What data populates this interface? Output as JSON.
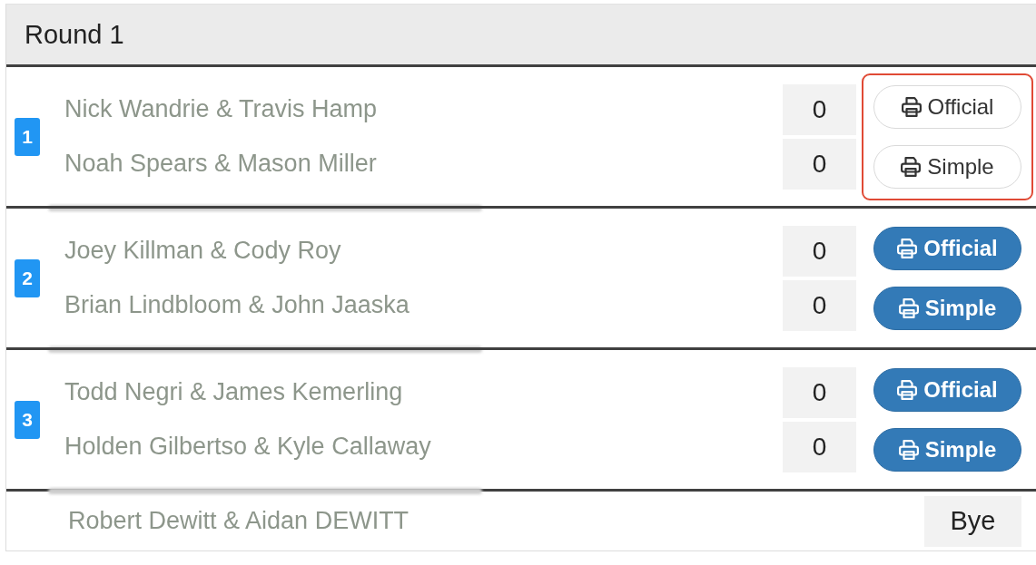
{
  "title": "Round 1",
  "matches": [
    {
      "number": "1",
      "highlighted": true,
      "teams": [
        {
          "name": "Nick Wandrie & Travis Hamp",
          "score": "0"
        },
        {
          "name": "Noah Spears & Mason Miller",
          "score": "0"
        }
      ],
      "buttons": [
        {
          "label": "Official",
          "kind": "outline"
        },
        {
          "label": "Simple",
          "kind": "outline"
        }
      ]
    },
    {
      "number": "2",
      "highlighted": false,
      "teams": [
        {
          "name": "Joey Killman & Cody Roy",
          "score": "0"
        },
        {
          "name": "Brian Lindbloom & John Jaaska",
          "score": "0"
        }
      ],
      "buttons": [
        {
          "label": "Official",
          "kind": "solid"
        },
        {
          "label": "Simple",
          "kind": "solid"
        }
      ]
    },
    {
      "number": "3",
      "highlighted": false,
      "teams": [
        {
          "name": "Todd Negri & James Kemerling",
          "score": "0"
        },
        {
          "name": "Holden Gilbertso & Kyle Callaway",
          "score": "0"
        }
      ],
      "buttons": [
        {
          "label": "Official",
          "kind": "solid"
        },
        {
          "label": "Simple",
          "kind": "solid"
        }
      ]
    }
  ],
  "bye": {
    "name": "Robert Dewitt & Aidan DEWITT",
    "label": "Bye"
  }
}
